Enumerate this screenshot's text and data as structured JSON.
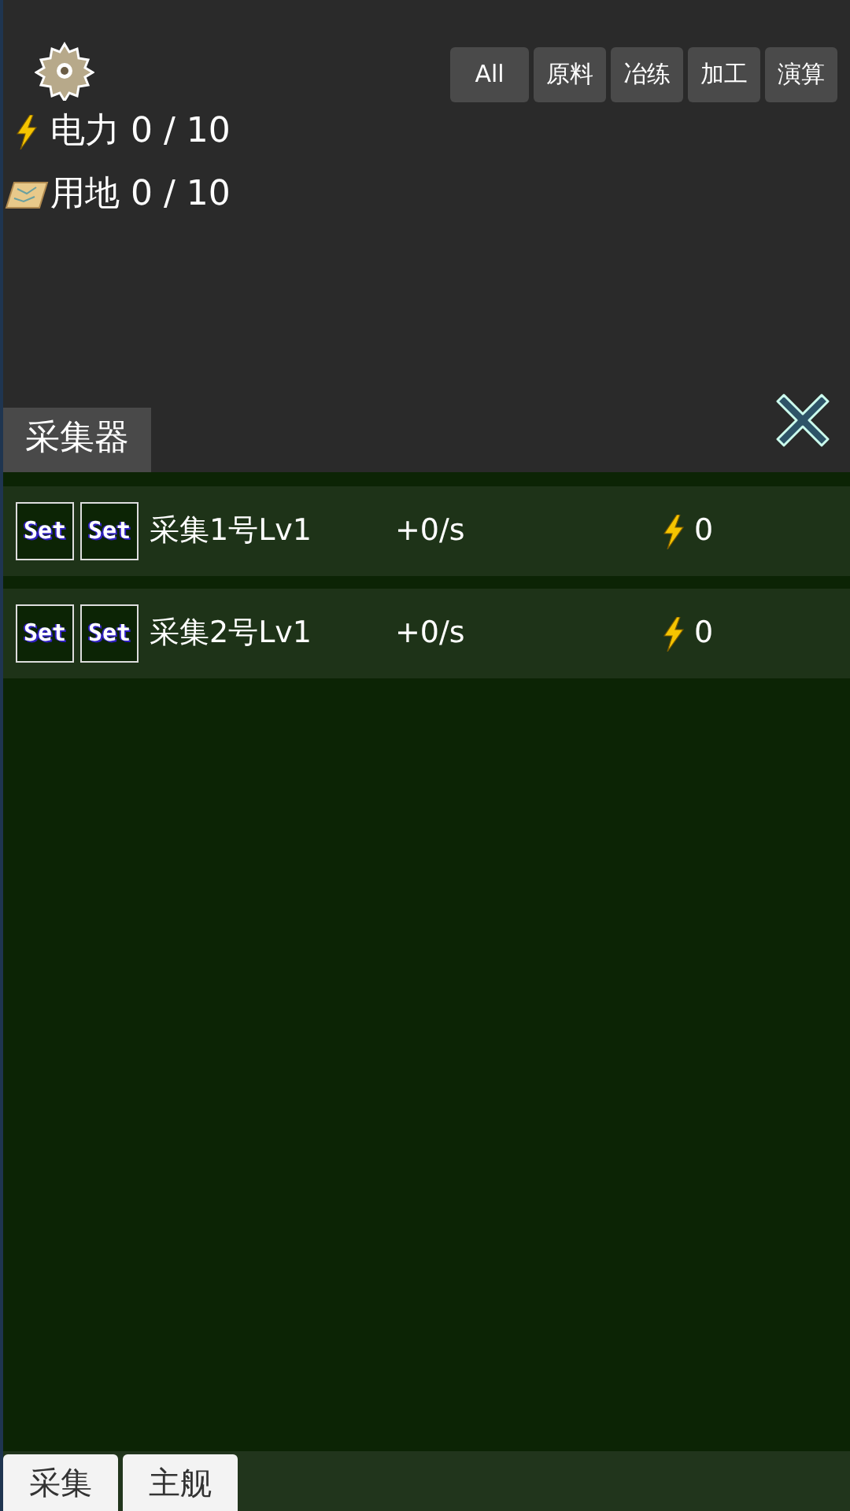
{
  "filters": [
    "All",
    "原料",
    "冶练",
    "加工",
    "演算"
  ],
  "stats": [
    {
      "kind": "power",
      "label": "电力 0 / 10"
    },
    {
      "kind": "land",
      "label": "用地 0 / 10"
    }
  ],
  "panel": {
    "title": "采集器",
    "rows": [
      {
        "set_buttons": [
          "Set",
          "Set"
        ],
        "name": "采集1号Lv1",
        "rate": "+0/s",
        "power": "0"
      },
      {
        "set_buttons": [
          "Set",
          "Set"
        ],
        "name": "采集2号Lv1",
        "rate": "+0/s",
        "power": "0"
      }
    ]
  },
  "bottom_tabs": [
    "采集",
    "主舰"
  ]
}
